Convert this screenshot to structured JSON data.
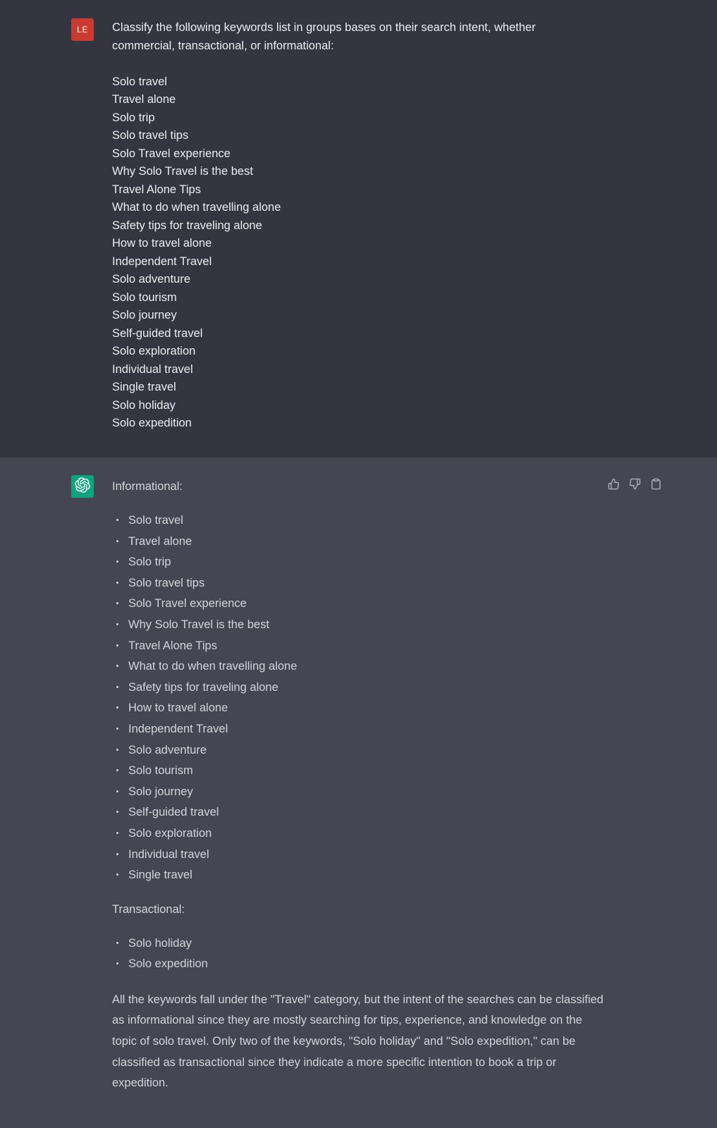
{
  "user": {
    "avatar_initials": "LE",
    "avatar_color": "#c93a31",
    "prompt": "Classify the following keywords list in groups bases on their search intent, whether commercial, transactional, or informational:",
    "keywords": [
      "Solo travel",
      "Travel alone",
      "Solo trip",
      "Solo travel tips",
      "Solo Travel experience",
      "Why Solo Travel is the best",
      "Travel Alone Tips",
      "What to do when travelling alone",
      "Safety tips for traveling alone",
      "How to travel alone",
      "Independent Travel",
      "Solo adventure",
      "Solo tourism",
      "Solo journey",
      "Self-guided travel",
      "Solo exploration",
      "Individual travel",
      "Single travel",
      "Solo holiday",
      "Solo expedition"
    ]
  },
  "assistant": {
    "avatar_icon": "openai-logo-icon",
    "avatar_color": "#10a37f",
    "actions": {
      "like": "thumbs-up-icon",
      "dislike": "thumbs-down-icon",
      "copy": "clipboard-icon"
    },
    "informational": {
      "heading": "Informational:",
      "items": [
        "Solo travel",
        "Travel alone",
        "Solo trip",
        "Solo travel tips",
        "Solo Travel experience",
        "Why Solo Travel is the best",
        "Travel Alone Tips",
        "What to do when travelling alone",
        "Safety tips for traveling alone",
        "How to travel alone",
        "Independent Travel",
        "Solo adventure",
        "Solo tourism",
        "Solo journey",
        "Self-guided travel",
        "Solo exploration",
        "Individual travel",
        "Single travel"
      ]
    },
    "transactional": {
      "heading": "Transactional:",
      "items": [
        "Solo holiday",
        "Solo expedition"
      ]
    },
    "summary": "All the keywords fall under the \"Travel\" category, but the intent of the searches can be classified as informational since they are mostly searching for tips, experience, and knowledge on the topic of solo travel. Only two of the keywords, \"Solo holiday\" and \"Solo expedition,\" can be classified as transactional since they indicate a more specific intention to book a trip or expedition."
  },
  "colors": {
    "user_bg": "#343541",
    "assistant_bg": "#444654",
    "user_text": "#ececf1",
    "assistant_text": "#d1d5db"
  }
}
